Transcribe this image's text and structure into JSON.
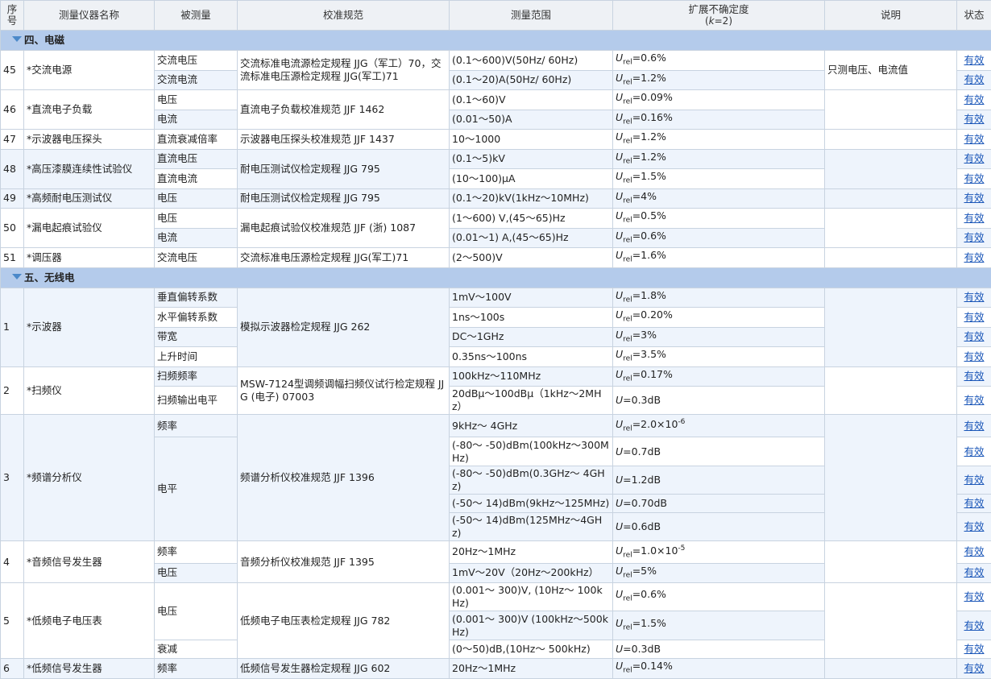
{
  "headers": {
    "seq": "序号",
    "name": "测量仪器名称",
    "quantity": "被测量",
    "standard": "校准规范",
    "range": "测量范围",
    "uncert_line1": "扩展不确定度",
    "uncert_line2_pre": "(",
    "uncert_line2_k": "k",
    "uncert_line2_post": "=2)",
    "note": "说明",
    "status": "状态"
  },
  "sections": {
    "s4": "四、电磁",
    "s5": "五、无线电"
  },
  "status_text": "有效",
  "rows": {
    "r45": {
      "seq": "45",
      "name": "*交流电源",
      "standard": "交流标准电流源检定规程 JJG（军工）70，交流标准电压源检定规程 JJG(军工)71",
      "note": "只测电压、电流值",
      "subs": [
        {
          "quantity": "交流电压",
          "range": "(0.1～600)V(50Hz/ 60Hz)",
          "u": "=0.6%"
        },
        {
          "quantity": "交流电流",
          "range": "(0.1～20)A(50Hz/ 60Hz)",
          "u": "=1.2%"
        }
      ]
    },
    "r46": {
      "seq": "46",
      "name": "*直流电子负载",
      "standard": "直流电子负载校准规范 JJF 1462",
      "subs": [
        {
          "quantity": "电压",
          "range": "(0.1～60)V",
          "u": "=0.09%"
        },
        {
          "quantity": "电流",
          "range": "(0.01～50)A",
          "u": "=0.16%"
        }
      ]
    },
    "r47": {
      "seq": "47",
      "name": "*示波器电压探头",
      "standard": "示波器电压探头校准规范 JJF 1437",
      "quantity": "直流衰减倍率",
      "range": "10～1000",
      "u": "=1.2%"
    },
    "r48": {
      "seq": "48",
      "name": "*高压漆膜连续性试验仪",
      "standard": "耐电压测试仪检定规程 JJG 795",
      "subs": [
        {
          "quantity": "直流电压",
          "range": "(0.1～5)kV",
          "u": "=1.2%"
        },
        {
          "quantity": "直流电流",
          "range": "(10～100)μA",
          "u": "=1.5%"
        }
      ]
    },
    "r49": {
      "seq": "49",
      "name": "*高频耐电压测试仪",
      "standard": "耐电压测试仪检定规程 JJG 795",
      "quantity": "电压",
      "range": "(0.1～20)kV(1kHz～10MHz)",
      "u": "=4%"
    },
    "r50": {
      "seq": "50",
      "name": "*漏电起痕试验仪",
      "standard": "漏电起痕试验仪校准规范 JJF (浙) 1087",
      "subs": [
        {
          "quantity": "电压",
          "range": "(1～600) V,(45～65)Hz",
          "u": "=0.5%"
        },
        {
          "quantity": "电流",
          "range": "(0.01～1) A,(45～65)Hz",
          "u": "=0.6%"
        }
      ]
    },
    "r51": {
      "seq": "51",
      "name": "*调压器",
      "standard": "交流标准电压源检定规程 JJG(军工)71",
      "quantity": "交流电压",
      "range": "(2～500)V",
      "u": "=1.6%"
    },
    "w1": {
      "seq": "1",
      "name": "*示波器",
      "standard": "模拟示波器检定规程 JJG 262",
      "subs": [
        {
          "quantity": "垂直偏转系数",
          "range": "1mV～100V",
          "u": "=1.8%"
        },
        {
          "quantity": "水平偏转系数",
          "range": "1ns～100s",
          "u": "=0.20%"
        },
        {
          "quantity": "带宽",
          "range": "DC～1GHz",
          "u": "=3%"
        },
        {
          "quantity": "上升时间",
          "range": "0.35ns～100ns",
          "u": "=3.5%"
        }
      ]
    },
    "w2": {
      "seq": "2",
      "name": "*扫频仪",
      "standard": "MSW-7124型调频调幅扫频仪试行检定规程 JJG (电子) 07003",
      "subs": [
        {
          "quantity": "扫频频率",
          "range": "100kHz～110MHz",
          "u": "=0.17%"
        },
        {
          "quantity": "扫频输出电平",
          "range": "20dBμ～100dBμ（1kHz～2MHz）",
          "u": "=0.3dB"
        }
      ]
    },
    "w3": {
      "seq": "3",
      "name": "*频谱分析仪",
      "standard": "频谱分析仪校准规范 JJF 1396",
      "q1": "频率",
      "q2": "电平",
      "subs": [
        {
          "range": "9kHz～ 4GHz",
          "u": "=2.0×10",
          "exp": "-6"
        },
        {
          "range": "(-80～ -50)dBm(100kHz～300MHz)",
          "u": "=0.7dB"
        },
        {
          "range": "(-80～ -50)dBm(0.3GHz～ 4GHz)",
          "u": "=1.2dB"
        },
        {
          "range": "(-50～ 14)dBm(9kHz～125MHz)",
          "u": "=0.70dB"
        },
        {
          "range": "(-50～ 14)dBm(125MHz～4GHz)",
          "u": "=0.6dB"
        }
      ]
    },
    "w4": {
      "seq": "4",
      "name": "*音频信号发生器",
      "standard": "音频分析仪校准规范 JJF 1395",
      "subs": [
        {
          "quantity": "频率",
          "range": "20Hz～1MHz",
          "u": "=1.0×10",
          "exp": "-5"
        },
        {
          "quantity": "电压",
          "range": "1mV～20V（20Hz～200kHz）",
          "u": "=5%"
        }
      ]
    },
    "w5": {
      "seq": "5",
      "name": "*低频电子电压表",
      "standard": "低频电子电压表检定规程 JJG 782",
      "q1": "电压",
      "q2": "衰减",
      "subs": [
        {
          "range": "(0.001～ 300)V, (10Hz～ 100kHz)",
          "u": "=0.6%"
        },
        {
          "range": "(0.001～ 300)V (100kHz～500kHz)",
          "u": "=1.5%"
        },
        {
          "range": "(0～50)dB,(10Hz～ 500kHz)",
          "u": "=0.3dB"
        }
      ]
    },
    "w6": {
      "seq": "6",
      "name": "*低频信号发生器",
      "standard": "低频信号发生器检定规程 JJG 602",
      "quantity": "频率",
      "range": "20Hz～1MHz",
      "u": "=0.14%"
    }
  }
}
